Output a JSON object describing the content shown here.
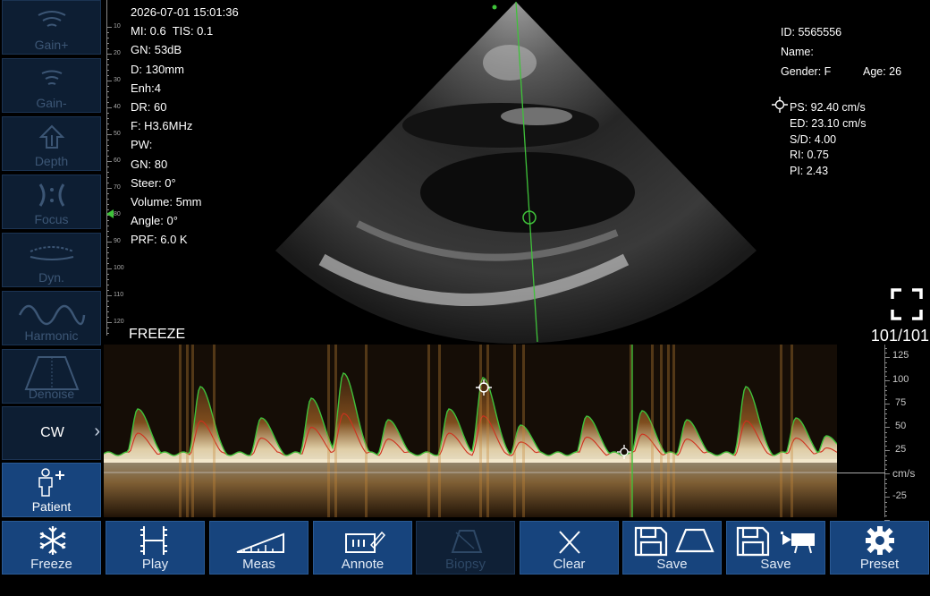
{
  "left_panel": {
    "gain_plus": "Gain+",
    "gain_minus": "Gain-",
    "depth": "Depth",
    "focus": "Focus",
    "dyn": "Dyn.",
    "harmonic": "Harmonic",
    "denoise": "Denoise",
    "cw": "CW",
    "patient": "Patient"
  },
  "depth_scale": [
    "10",
    "20",
    "30",
    "40",
    "50",
    "60",
    "70",
    "80",
    "90",
    "100",
    "110",
    "120"
  ],
  "params": {
    "datetime": "2026-07-01 15:01:36",
    "mi_tis": "MI: 0.6  TIS: 0.1",
    "gn": "GN: 53dB",
    "depth": "D: 130mm",
    "enh": "Enh:4",
    "dr": "DR: 60",
    "freq": "F: H3.6MHz",
    "pw": "PW:",
    "pw_gn": "GN: 80",
    "steer": "Steer: 0°",
    "volume": "Volume: 5mm",
    "angle": "Angle: 0°",
    "prf": "PRF: 6.0 K"
  },
  "patient_info": {
    "id": "ID: 5565556",
    "name": "Name:",
    "gender": "Gender: F",
    "age": "Age: 26"
  },
  "measurements": {
    "ps": "PS: 92.40 cm/s",
    "ed": "ED: 23.10 cm/s",
    "sd": "S/D: 4.00",
    "ri": "RI: 0.75",
    "pi": "PI: 2.43"
  },
  "status": {
    "freeze_label": "FREEZE",
    "frame_counter": "101/101"
  },
  "velocity_scale": {
    "ticks": [
      "125",
      "100",
      "75",
      "50",
      "25",
      "cm/s",
      "-25"
    ]
  },
  "toolbar": {
    "freeze": "Freeze",
    "play": "Play",
    "meas": "Meas",
    "annote": "Annote",
    "biopsy": "Biopsy",
    "clear": "Clear",
    "save_image": "Save",
    "save_video": "Save",
    "preset": "Preset"
  },
  "colors": {
    "button_active": "#17447d",
    "button_inactive": "#0d1e33",
    "envelope_max": "#3fc23a",
    "envelope_mean": "#d0301e",
    "cursor_line": "#3fc23a"
  }
}
